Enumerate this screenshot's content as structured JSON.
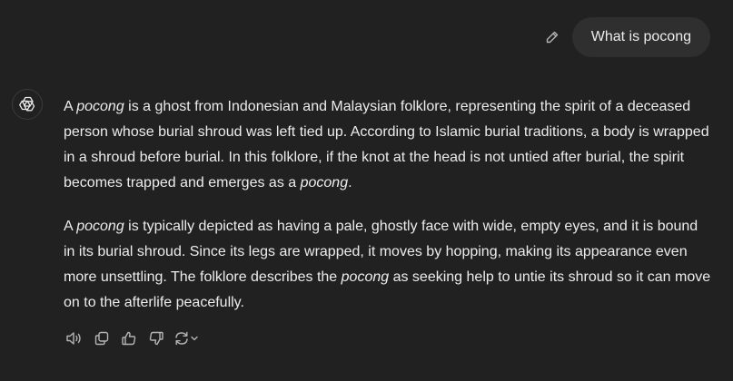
{
  "user_message": {
    "text": "What is pocong",
    "edit_icon": "pencil-icon"
  },
  "assistant": {
    "avatar_icon": "openai-logo-icon",
    "paragraphs": [
      [
        {
          "t": "A "
        },
        {
          "t": "pocong",
          "i": true
        },
        {
          "t": " is a ghost from Indonesian and Malaysian folklore, representing the spirit of a deceased person whose burial shroud was left tied up. According to Islamic burial traditions, a body is wrapped in a shroud before burial. In this folklore, if the knot at the head is not untied after burial, the spirit becomes trapped and emerges as a "
        },
        {
          "t": "pocong",
          "i": true
        },
        {
          "t": "."
        }
      ],
      [
        {
          "t": "A "
        },
        {
          "t": "pocong",
          "i": true
        },
        {
          "t": " is typically depicted as having a pale, ghostly face with wide, empty eyes, and it is bound in its burial shroud. Since its legs are wrapped, it moves by hopping, making its appearance even more unsettling. The folklore describes the "
        },
        {
          "t": "pocong",
          "i": true
        },
        {
          "t": " as seeking help to untie its shroud so it can move on to the afterlife peacefully."
        }
      ]
    ]
  },
  "actions": [
    "read-aloud-icon",
    "copy-icon",
    "thumbs-up-icon",
    "thumbs-down-icon",
    "regenerate-icon",
    "chevron-down-icon"
  ],
  "colors": {
    "background": "#212121",
    "bubble": "#2f2f2f",
    "text": "#ececec",
    "icon": "#b4b4b4"
  }
}
